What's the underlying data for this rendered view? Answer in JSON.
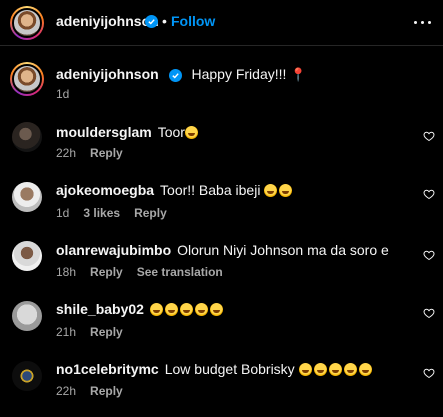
{
  "header": {
    "username": "adeniyijohnson",
    "follow_label": "Follow",
    "separator": "•"
  },
  "caption": {
    "username": "adeniyijohnson",
    "text": "Happy Friday!!!",
    "time": "1d",
    "emoji": "round-pushpin"
  },
  "comments": [
    {
      "username": "mouldersglam",
      "text": "Toor",
      "emoji_count": 1,
      "time": "22h",
      "likes": "",
      "reply": "Reply",
      "extra": ""
    },
    {
      "username": "ajokeomoegba",
      "text": "Toor!! Baba ibeji",
      "emoji_count": 2,
      "time": "1d",
      "likes": "3 likes",
      "reply": "Reply",
      "extra": ""
    },
    {
      "username": "olanrewajubimbo",
      "text": "Olorun Niyi Johnson ma da soro e",
      "emoji_count": 0,
      "time": "18h",
      "likes": "",
      "reply": "Reply",
      "extra": "See translation"
    },
    {
      "username": "shile_baby02",
      "text": "",
      "emoji_count": 5,
      "time": "21h",
      "likes": "",
      "reply": "Reply",
      "extra": ""
    },
    {
      "username": "no1celebritymc",
      "text": "Low budget Bobrisky",
      "emoji_count": 5,
      "time": "22h",
      "likes": "",
      "reply": "Reply",
      "extra": ""
    }
  ],
  "colors": {
    "background": "#000000",
    "accent": "#0095f6",
    "muted": "#a8a8a8",
    "text": "#f5f5f5"
  }
}
